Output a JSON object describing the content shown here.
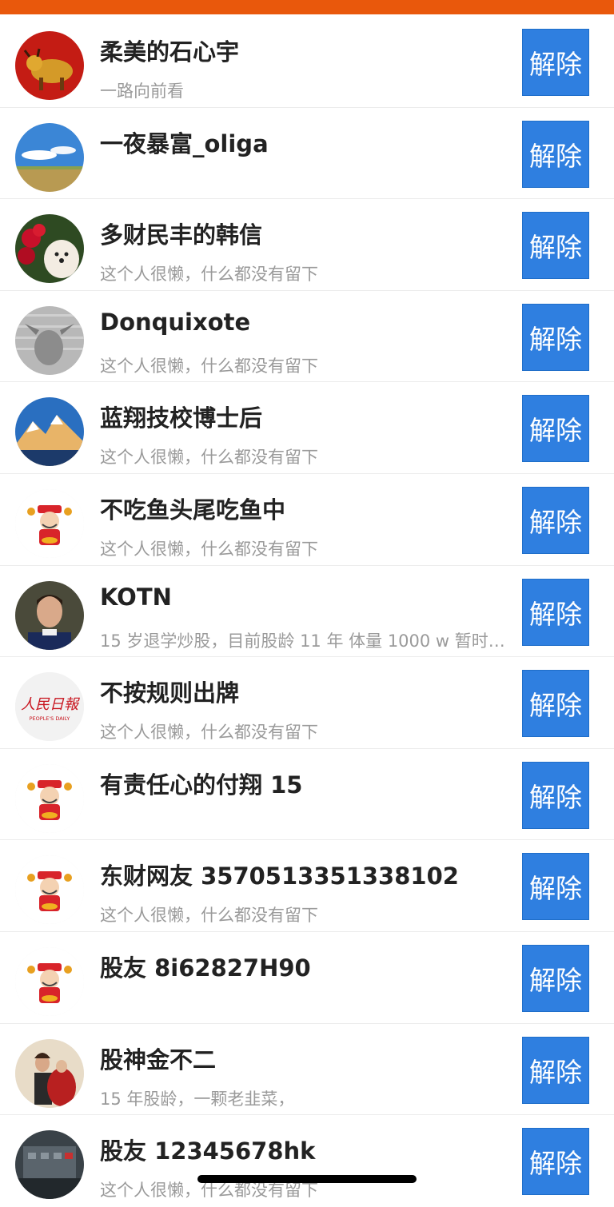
{
  "button_label": "解除",
  "colors": {
    "top_bar": "#E9580C",
    "button": "#2F7FE0",
    "name_text": "#222222",
    "bio_text": "#9a9a9a"
  },
  "users": [
    {
      "name": "柔美的石心宇",
      "bio": "一路向前看",
      "avatar": "bull-photo"
    },
    {
      "name": "一夜暴富_oliga",
      "bio": "",
      "avatar": "sky-landscape-photo"
    },
    {
      "name": "多财民丰的韩信",
      "bio": "这个人很懒，什么都没有留下",
      "avatar": "dog-with-roses-photo"
    },
    {
      "name": "Donquixote",
      "bio": "这个人很懒，什么都没有留下",
      "avatar": "gray-statue-photo"
    },
    {
      "name": "蓝翔技校博士后",
      "bio": "这个人很懒，什么都没有留下",
      "avatar": "mountain-photo"
    },
    {
      "name": "不吃鱼头尾吃鱼中",
      "bio": "这个人很懒，什么都没有留下",
      "avatar": "god-of-wealth-cartoon"
    },
    {
      "name": "KOTN",
      "bio": "15 岁退学炒股，目前股龄 11 年 体量 1000 w 暂时…",
      "avatar": "man-portrait-photo"
    },
    {
      "name": "不按规则出牌",
      "bio": "这个人很懒，什么都没有留下",
      "avatar": "peoples-daily-logo"
    },
    {
      "name": "有责任心的付翔 15",
      "bio": "",
      "avatar": "god-of-wealth-cartoon"
    },
    {
      "name": "东财网友 3570513351338102",
      "bio": "这个人很懒，什么都没有留下",
      "avatar": "god-of-wealth-cartoon"
    },
    {
      "name": "股友 8i62827H90",
      "bio": "",
      "avatar": "god-of-wealth-cartoon"
    },
    {
      "name": "股神金不二",
      "bio": "15 年股龄，一颗老韭菜，",
      "avatar": "painting-photo"
    },
    {
      "name": "股友 12345678hk",
      "bio": "这个人很懒，什么都没有留下",
      "avatar": "building-photo"
    }
  ],
  "avatar_logo_text": {
    "title": "人民日報",
    "subtitle": "PEOPLE'S DAILY"
  }
}
